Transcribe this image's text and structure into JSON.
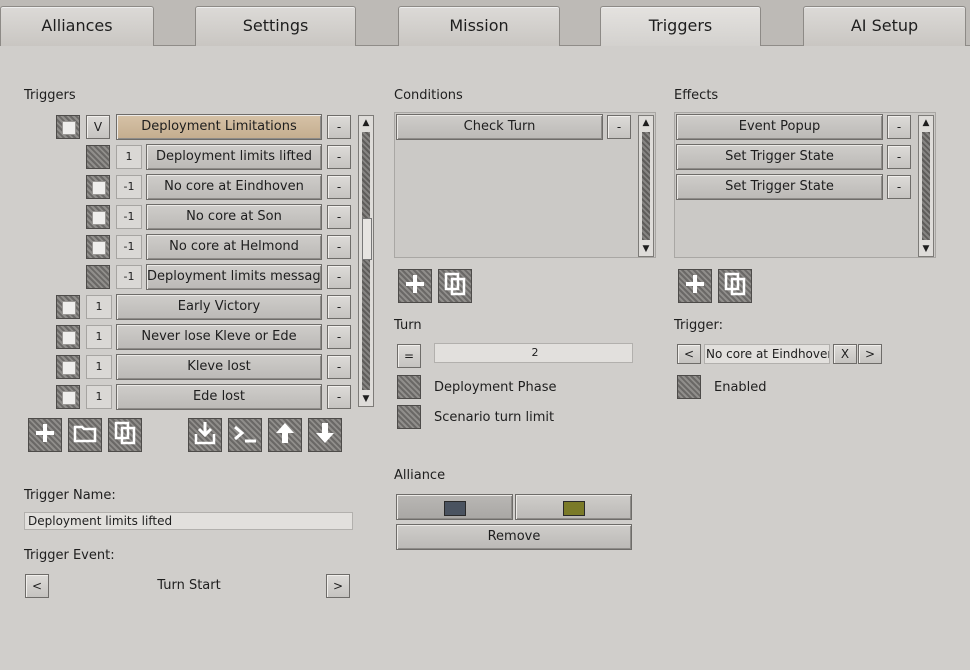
{
  "tabs": [
    {
      "label": "Alliances"
    },
    {
      "label": "Settings"
    },
    {
      "label": "Mission"
    },
    {
      "label": "Triggers"
    },
    {
      "label": "AI Setup"
    }
  ],
  "triggers": {
    "heading": "Triggers",
    "minus": "-",
    "expand_toggle": "V",
    "items": [
      {
        "label": "Deployment Limitations",
        "num": "V"
      },
      {
        "label": "Deployment limits lifted",
        "num": "1"
      },
      {
        "label": "No core at Eindhoven",
        "num": "-1"
      },
      {
        "label": "No core at Son",
        "num": "-1"
      },
      {
        "label": "No core at Helmond",
        "num": "-1"
      },
      {
        "label": "Deployment limits message",
        "num": "-1"
      },
      {
        "label": "Early Victory",
        "num": "1"
      },
      {
        "label": "Never lose Kleve or Ede",
        "num": "1"
      },
      {
        "label": "Kleve lost",
        "num": "1"
      },
      {
        "label": "Ede lost",
        "num": "1"
      }
    ],
    "name_label": "Trigger Name:",
    "name_value": "Deployment limits lifted",
    "event_label": "Trigger Event:",
    "event_value": "Turn Start",
    "event_prev": "<",
    "event_next": ">"
  },
  "conditions": {
    "heading": "Conditions",
    "items": [
      {
        "label": "Check Turn"
      }
    ],
    "turn_label": "Turn",
    "turn_operator": "=",
    "turn_value": "2",
    "deployment_phase": "Deployment Phase",
    "scenario_turn_limit": "Scenario turn limit",
    "alliance_label": "Alliance",
    "alliance_colors": [
      "#4a5360",
      "#7a7a28"
    ],
    "remove_label": "Remove"
  },
  "effects": {
    "heading": "Effects",
    "items": [
      {
        "label": "Event Popup"
      },
      {
        "label": "Set Trigger State"
      },
      {
        "label": "Set Trigger State"
      }
    ],
    "trigger_label": "Trigger:",
    "trigger_prev": "<",
    "trigger_value": "No core at Eindhoven",
    "trigger_clear": "X",
    "trigger_next": ">",
    "enabled_label": "Enabled"
  }
}
